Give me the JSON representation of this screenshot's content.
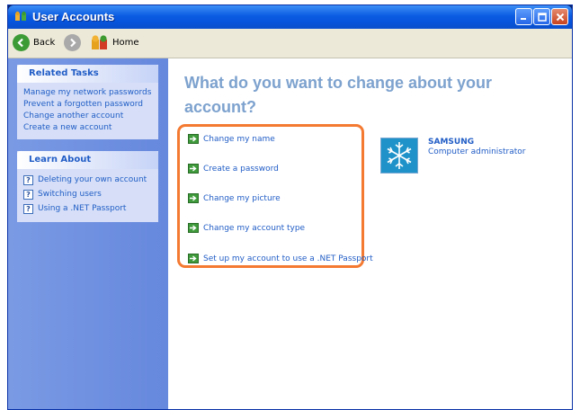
{
  "window": {
    "title": "User Accounts",
    "controls": [
      "minimize-icon",
      "maximize-icon",
      "close-icon"
    ]
  },
  "toolbar": {
    "back_label": "Back",
    "home_label": "Home"
  },
  "sidebar": {
    "related_tasks": {
      "title": "Related Tasks",
      "items": [
        "Manage my network passwords",
        "Prevent a forgotten password",
        "Change another account",
        "Create a new account"
      ]
    },
    "learn_about": {
      "title": "Learn About",
      "items": [
        "Deleting your own account",
        "Switching users",
        "Using a .NET Passport"
      ]
    }
  },
  "main": {
    "heading": "What do you want to change about your account?",
    "options": [
      "Change my name",
      "Create a password",
      "Change my picture",
      "Change my account type",
      "Set up my account to use a .NET Passport"
    ],
    "account": {
      "name": "SAMSUNG",
      "role": "Computer administrator",
      "picture": "snowflake-icon"
    }
  },
  "colors": {
    "titlebar": "#0b5ce2",
    "sidebar": "#6f8fe0",
    "link": "#215dc6",
    "heading": "#7da2ce",
    "highlight": "#f47a32"
  }
}
